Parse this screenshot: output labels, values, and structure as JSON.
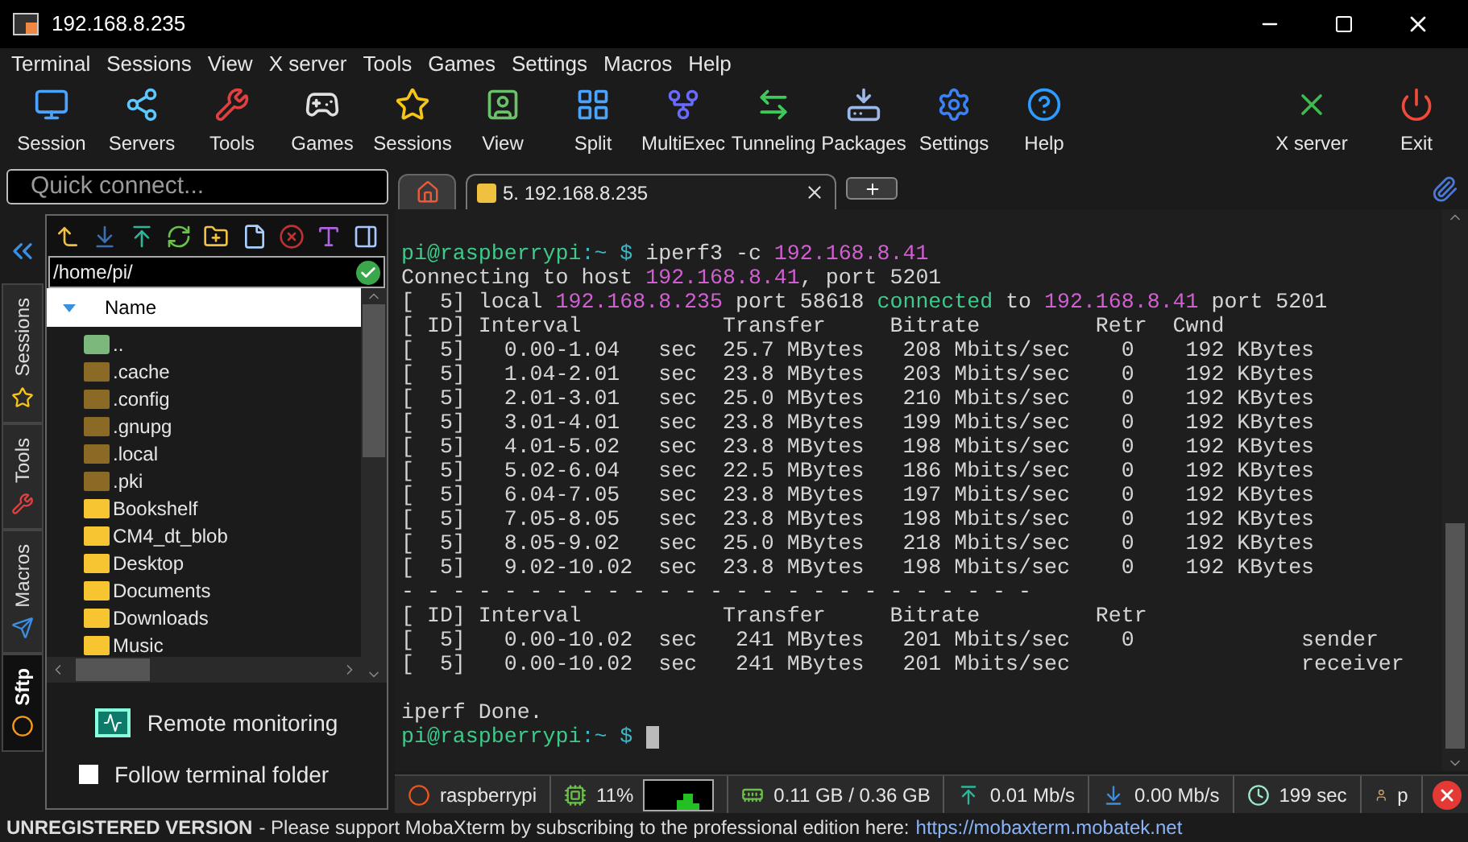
{
  "window": {
    "title": "192.168.8.235"
  },
  "menu": [
    "Terminal",
    "Sessions",
    "View",
    "X server",
    "Tools",
    "Games",
    "Settings",
    "Macros",
    "Help"
  ],
  "toolbar": {
    "left": [
      "Session",
      "Servers",
      "Tools",
      "Games",
      "Sessions",
      "View",
      "Split",
      "MultiExec",
      "Tunneling",
      "Packages",
      "Settings",
      "Help"
    ],
    "right": [
      "X server",
      "Exit"
    ]
  },
  "quick_connect": {
    "placeholder": "Quick connect..."
  },
  "tabs": [
    {
      "kind": "home",
      "selected": false
    },
    {
      "kind": "session",
      "label": "5. 192.168.8.235",
      "selected": true
    }
  ],
  "sidebar_tabs": [
    {
      "label": "Sessions",
      "selected": false
    },
    {
      "label": "Tools",
      "selected": false
    },
    {
      "label": "Macros",
      "selected": false
    },
    {
      "label": "Sftp",
      "selected": true
    }
  ],
  "sftp": {
    "path": "/home/pi/",
    "column": "Name",
    "files": [
      {
        "name": "..",
        "kind": "up"
      },
      {
        "name": ".cache",
        "kind": "hidden"
      },
      {
        "name": ".config",
        "kind": "hidden"
      },
      {
        "name": ".gnupg",
        "kind": "hidden"
      },
      {
        "name": ".local",
        "kind": "hidden"
      },
      {
        "name": ".pki",
        "kind": "hidden"
      },
      {
        "name": "Bookshelf",
        "kind": "folder"
      },
      {
        "name": "CM4_dt_blob",
        "kind": "folder"
      },
      {
        "name": "Desktop",
        "kind": "folder"
      },
      {
        "name": "Documents",
        "kind": "folder"
      },
      {
        "name": "Downloads",
        "kind": "folder"
      },
      {
        "name": "Music",
        "kind": "folder"
      }
    ],
    "remote_monitoring": "Remote monitoring",
    "follow_folder": {
      "label": "Follow terminal folder",
      "checked": false
    }
  },
  "terminal": {
    "lines": [
      {
        "segments": [
          {
            "t": "pi@raspberrypi",
            "kind": "user"
          },
          {
            "t": ":~ $ ",
            "kind": "path"
          },
          {
            "t": "iperf3 -c ",
            "kind": "plain"
          },
          {
            "t": "192.168.8.41",
            "kind": "ip"
          }
        ]
      },
      {
        "segments": [
          {
            "t": "Connecting to host ",
            "kind": "plain"
          },
          {
            "t": "192.168.8.41",
            "kind": "ip"
          },
          {
            "t": ", port 5201",
            "kind": "plain"
          }
        ]
      },
      {
        "segments": [
          {
            "t": "[  5] local ",
            "kind": "plain"
          },
          {
            "t": "192.168.8.235",
            "kind": "ip"
          },
          {
            "t": " port 58618 ",
            "kind": "plain"
          },
          {
            "t": "connected",
            "kind": "ok"
          },
          {
            "t": " to ",
            "kind": "plain"
          },
          {
            "t": "192.168.8.41",
            "kind": "ip"
          },
          {
            "t": " port 5201",
            "kind": "plain"
          }
        ]
      },
      {
        "segments": [
          {
            "t": "[ ID] Interval           Transfer     Bitrate         Retr  Cwnd",
            "kind": "plain"
          }
        ]
      },
      {
        "segments": [
          {
            "t": "[  5]   0.00-1.04   sec  25.7 MBytes   208 Mbits/sec    0    192 KBytes",
            "kind": "plain"
          }
        ]
      },
      {
        "segments": [
          {
            "t": "[  5]   1.04-2.01   sec  23.8 MBytes   203 Mbits/sec    0    192 KBytes",
            "kind": "plain"
          }
        ]
      },
      {
        "segments": [
          {
            "t": "[  5]   2.01-3.01   sec  25.0 MBytes   210 Mbits/sec    0    192 KBytes",
            "kind": "plain"
          }
        ]
      },
      {
        "segments": [
          {
            "t": "[  5]   3.01-4.01   sec  23.8 MBytes   199 Mbits/sec    0    192 KBytes",
            "kind": "plain"
          }
        ]
      },
      {
        "segments": [
          {
            "t": "[  5]   4.01-5.02   sec  23.8 MBytes   198 Mbits/sec    0    192 KBytes",
            "kind": "plain"
          }
        ]
      },
      {
        "segments": [
          {
            "t": "[  5]   5.02-6.04   sec  22.5 MBytes   186 Mbits/sec    0    192 KBytes",
            "kind": "plain"
          }
        ]
      },
      {
        "segments": [
          {
            "t": "[  5]   6.04-7.05   sec  23.8 MBytes   197 Mbits/sec    0    192 KBytes",
            "kind": "plain"
          }
        ]
      },
      {
        "segments": [
          {
            "t": "[  5]   7.05-8.05   sec  23.8 MBytes   198 Mbits/sec    0    192 KBytes",
            "kind": "plain"
          }
        ]
      },
      {
        "segments": [
          {
            "t": "[  5]   8.05-9.02   sec  25.0 MBytes   218 Mbits/sec    0    192 KBytes",
            "kind": "plain"
          }
        ]
      },
      {
        "segments": [
          {
            "t": "[  5]   9.02-10.02  sec  23.8 MBytes   198 Mbits/sec    0    192 KBytes",
            "kind": "plain"
          }
        ]
      },
      {
        "segments": [
          {
            "t": "- - - - - - - - - - - - - - - - - - - - - - - - -",
            "kind": "plain"
          }
        ]
      },
      {
        "segments": [
          {
            "t": "[ ID] Interval           Transfer     Bitrate         Retr",
            "kind": "plain"
          }
        ]
      },
      {
        "segments": [
          {
            "t": "[  5]   0.00-10.02  sec   241 MBytes   201 Mbits/sec    0             sender",
            "kind": "plain"
          }
        ]
      },
      {
        "segments": [
          {
            "t": "[  5]   0.00-10.02  sec   241 MBytes   201 Mbits/sec                  receiver",
            "kind": "plain"
          }
        ]
      },
      {
        "gap_before": true,
        "segments": [
          {
            "t": "iperf Done.",
            "kind": "plain"
          }
        ]
      },
      {
        "cursor": true,
        "segments": [
          {
            "t": "pi@raspberrypi",
            "kind": "user"
          },
          {
            "t": ":~ $ ",
            "kind": "path"
          }
        ]
      }
    ]
  },
  "status_bar": [
    {
      "kind": "host",
      "text": "raspberrypi"
    },
    {
      "kind": "cpu",
      "text": "11%"
    },
    {
      "kind": "memory",
      "text": "0.11 GB / 0.36 GB"
    },
    {
      "kind": "upload",
      "text": "0.01 Mb/s"
    },
    {
      "kind": "download",
      "text": "0.00 Mb/s"
    },
    {
      "kind": "uptime",
      "text": "199 sec"
    },
    {
      "kind": "user",
      "text": "p"
    }
  ],
  "footer": {
    "label": "UNREGISTERED VERSION",
    "message": "-  Please support MobaXterm by subscribing to the professional edition here:",
    "link": "https://mobaxterm.mobatek.net"
  }
}
